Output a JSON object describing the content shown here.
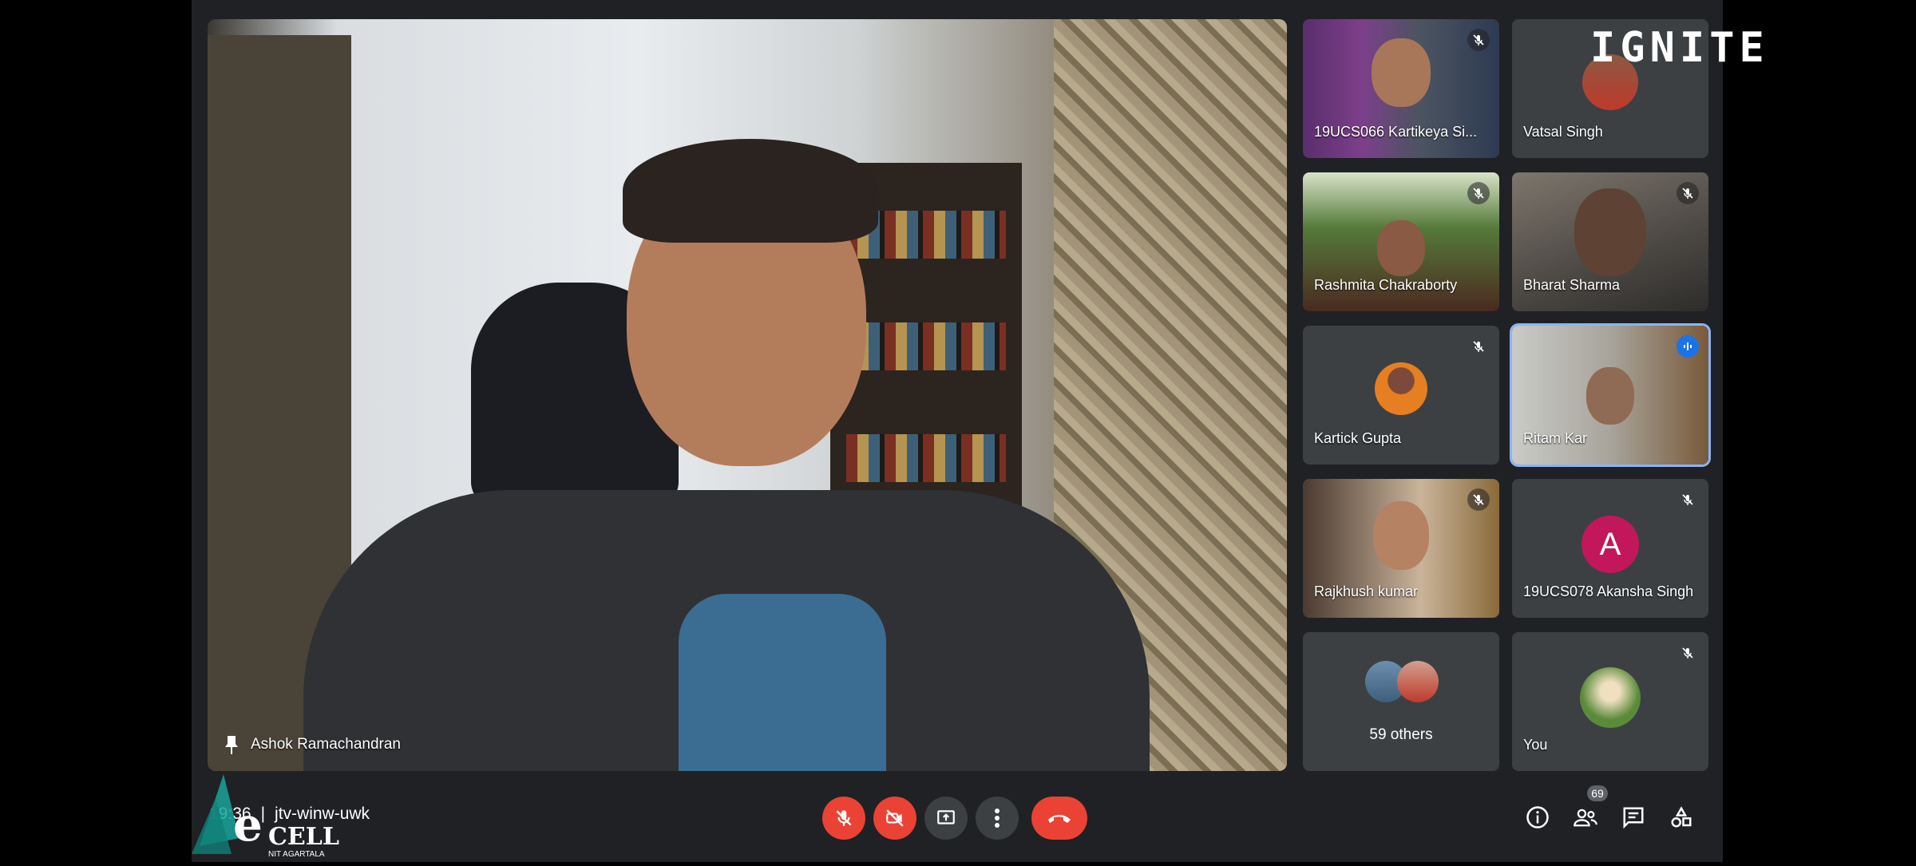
{
  "main_speaker": {
    "name": "Ashok Ramachandran"
  },
  "branding": {
    "overlay": "IGNITE",
    "logo_e": "e",
    "logo_cell": "CELL",
    "logo_sub": "NIT AGARTALA"
  },
  "participants": [
    {
      "name": "19UCS066 Kartikeya Si...",
      "muted": true
    },
    {
      "name": "Vatsal Singh",
      "muted": false
    },
    {
      "name": "Rashmita Chakraborty",
      "muted": true
    },
    {
      "name": "Bharat Sharma",
      "muted": true
    },
    {
      "name": "Kartick Gupta",
      "muted": true
    },
    {
      "name": "Ritam Kar",
      "speaking": true
    },
    {
      "name": "Rajkhush kumar",
      "muted": true
    },
    {
      "name": "19UCS078 Akansha Singh",
      "avatar_letter": "A",
      "avatar_color": "#c2185b",
      "muted": true
    },
    {
      "others": "59 others"
    },
    {
      "name": "You",
      "muted": true
    }
  ],
  "bottom": {
    "time": "19:36",
    "separator": "|",
    "meeting_code": "jtv-winw-uwk",
    "people_count": "69"
  },
  "colors": {
    "end_call": "#ea4335",
    "speaking": "#8ab4f8",
    "background": "#202124"
  }
}
